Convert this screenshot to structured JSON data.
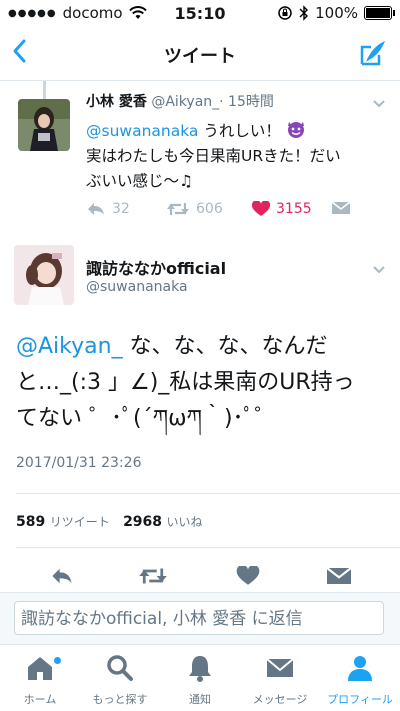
{
  "statusbar": {
    "carrier": "docomo",
    "time": "15:10",
    "battery": "100%",
    "battery_level": 1.0
  },
  "nav": {
    "title": "ツイート"
  },
  "reply_tweet": {
    "name": "小林 愛香",
    "handle": "@Aikyan_",
    "time": "· 15時間",
    "mention": "@suwananaka",
    "line1": " うれしい！",
    "line2": "実はわたしも今日果南URきた！だい",
    "line3": "ぶいい感じ〜♫",
    "reply_count": "32",
    "retweet_count": "606",
    "like_count": "3155"
  },
  "main_tweet": {
    "name": "諏訪ななかofficial",
    "handle": "@suwananaka",
    "mention": "@Aikyan_",
    "body_line1": " な、な、な、なんだ",
    "body_line2": "と…_(:3 」∠)_私は果南のUR持っ",
    "body_line3": "てない ゜･ﾟ(´ཀωཀ｀)･ﾟ゜",
    "date": "2017/01/31 23:26",
    "retweets": "589",
    "retweets_label": "リツイート",
    "likes": "2968",
    "likes_label": "いいね"
  },
  "reply_bar": {
    "placeholder": "諏訪ななかofficial, 小林 愛香 に返信"
  },
  "tabs": [
    {
      "label": "ホーム"
    },
    {
      "label": "もっと探す"
    },
    {
      "label": "通知"
    },
    {
      "label": "メッセージ"
    },
    {
      "label": "プロフィール"
    }
  ],
  "colors": {
    "accent": "#1da1f2",
    "like": "#e0245e",
    "icon_gray": "#657786"
  }
}
